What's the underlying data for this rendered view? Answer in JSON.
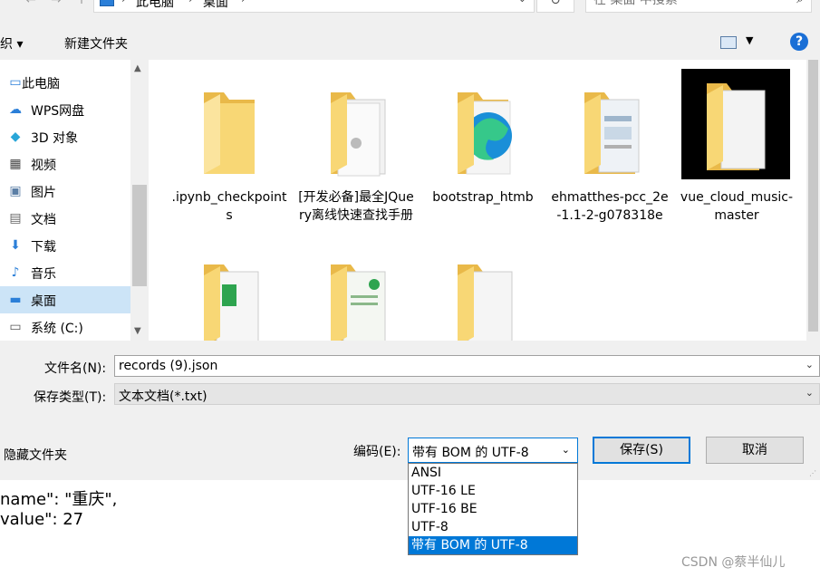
{
  "address": {
    "crumbs": [
      "此电脑",
      "桌面"
    ],
    "search_placeholder": "在 桌面 中搜索"
  },
  "toolbar": {
    "organize": "组织 ▾",
    "new_folder": "新建文件夹"
  },
  "nav": [
    {
      "label": "此电脑",
      "icon": "computer-icon"
    },
    {
      "label": "WPS网盘",
      "icon": "cloud-icon"
    },
    {
      "label": "3D 对象",
      "icon": "cube-icon"
    },
    {
      "label": "视频",
      "icon": "video-icon"
    },
    {
      "label": "图片",
      "icon": "picture-icon"
    },
    {
      "label": "文档",
      "icon": "document-icon"
    },
    {
      "label": "下载",
      "icon": "download-icon"
    },
    {
      "label": "音乐",
      "icon": "music-icon"
    },
    {
      "label": "桌面",
      "icon": "desktop-icon",
      "selected": true
    },
    {
      "label": "系统 (C:)",
      "icon": "drive-icon"
    }
  ],
  "files": [
    {
      "name": ".ipynb_checkpoints"
    },
    {
      "name": "[开发必备]最全JQuery离线快速查找手册"
    },
    {
      "name": "bootstrap_htmb"
    },
    {
      "name": "ehmatthes-pcc_2e-1.1-2-g078318e"
    },
    {
      "name": "vue_cloud_music-master"
    },
    {
      "name": ""
    },
    {
      "name": ""
    },
    {
      "name": ""
    }
  ],
  "form": {
    "filename_label": "文件名(N):",
    "filename_value": "records (9).json",
    "type_label": "保存类型(T):",
    "type_value": "文本文档(*.txt)",
    "hide_folders": "隐藏文件夹",
    "encoding_label": "编码(E):",
    "encoding_value": "带有 BOM 的 UTF-8",
    "save": "保存(S)",
    "cancel": "取消"
  },
  "encoding_options": [
    "ANSI",
    "UTF-16 LE",
    "UTF-16 BE",
    "UTF-8",
    "带有 BOM 的 UTF-8"
  ],
  "background": {
    "line1": "name\": \"重庆\",",
    "line2": "value\": 27"
  },
  "watermark": "CSDN @蔡半仙儿",
  "colors": {
    "accent": "#0078d7",
    "folder": "#f8d775",
    "selected_nav": "#cce4f7"
  }
}
